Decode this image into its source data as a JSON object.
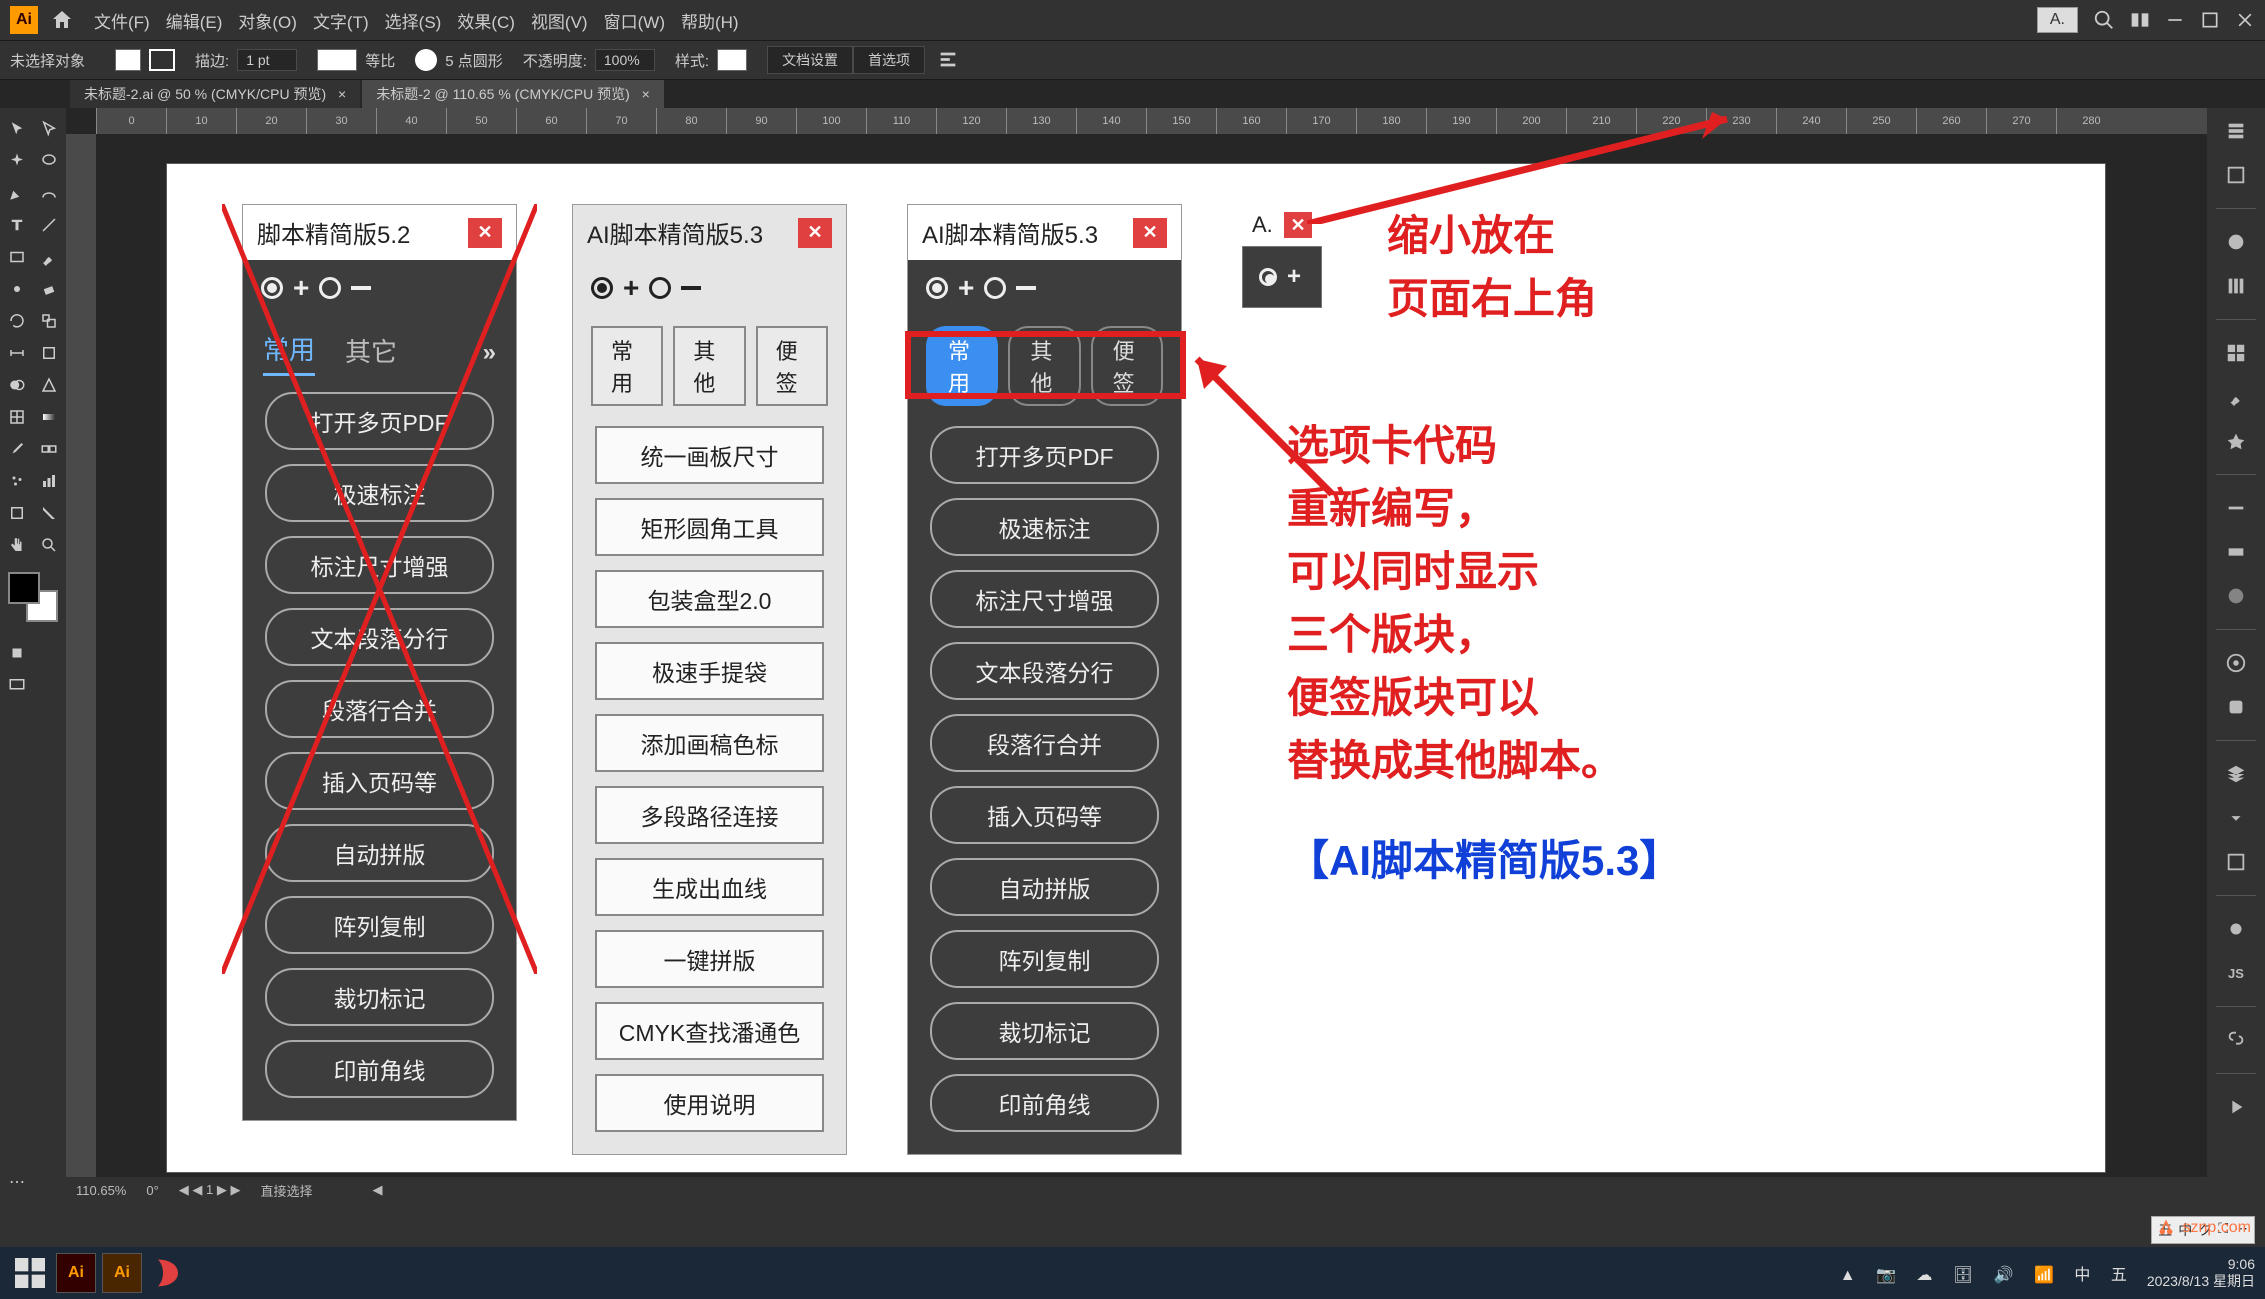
{
  "app": {
    "logo": "Ai"
  },
  "menus": [
    "文件(F)",
    "编辑(E)",
    "对象(O)",
    "文字(T)",
    "选择(S)",
    "效果(C)",
    "视图(V)",
    "窗口(W)",
    "帮助(H)"
  ],
  "topbar": {
    "mini_label": "A."
  },
  "control": {
    "no_selection": "未选择对象",
    "stroke_label": "描边:",
    "stroke_val": "1 pt",
    "uniform": "等比",
    "pt5": "5 点圆形",
    "opacity_label": "不透明度:",
    "opacity_val": "100%",
    "style_label": "样式:",
    "doc_setup": "文档设置",
    "prefs": "首选项"
  },
  "doc_tabs": [
    "未标题-2.ai @ 50 % (CMYK/CPU 预览)",
    "未标题-2 @ 110.65 % (CMYK/CPU 预览)"
  ],
  "ruler_ticks": [
    "0",
    "10",
    "20",
    "30",
    "40",
    "50",
    "60",
    "70",
    "80",
    "90",
    "100",
    "110",
    "120",
    "130",
    "140",
    "150",
    "160",
    "170",
    "180",
    "190",
    "200",
    "210",
    "220",
    "230",
    "240",
    "250",
    "260",
    "270",
    "280"
  ],
  "panel1": {
    "title": "脚本精简版5.2",
    "tabs": [
      "常用",
      "其它"
    ],
    "buttons": [
      "打开多页PDF",
      "极速标注",
      "标注尺寸增强",
      "文本段落分行",
      "段落行合并",
      "插入页码等",
      "自动拼版",
      "阵列复制",
      "裁切标记",
      "印前角线"
    ]
  },
  "panel2": {
    "title": "AI脚本精简版5.3",
    "tabs": [
      "常用",
      "其他",
      "便签"
    ],
    "buttons": [
      "统一画板尺寸",
      "矩形圆角工具",
      "包装盒型2.0",
      "极速手提袋",
      "添加画稿色标",
      "多段路径连接",
      "生成出血线",
      "一键拼版",
      "CMYK查找潘通色",
      "使用说明"
    ]
  },
  "panel3": {
    "title": "AI脚本精简版5.3",
    "tabs": [
      "常用",
      "其他",
      "便签"
    ],
    "buttons": [
      "打开多页PDF",
      "极速标注",
      "标注尺寸增强",
      "文本段落分行",
      "段落行合并",
      "插入页码等",
      "自动拼版",
      "阵列复制",
      "裁切标记",
      "印前角线"
    ]
  },
  "panel4": {
    "title": "A."
  },
  "annotation1": "缩小放在\n页面右上角",
  "annotation2": "选项卡代码\n重新编写，\n可以同时显示\n三个版块，\n便签版块可以\n替换成其他脚本。",
  "annotation3": "【AI脚本精简版5.3】",
  "status": {
    "zoom": "110.65%",
    "angle": "0°",
    "art": "1",
    "tool": "直接选择"
  },
  "tray": [
    "五",
    "中",
    "ク",
    "⛶",
    "⋯"
  ],
  "taskbar": {
    "time": "9:06",
    "date": "2023/8/13 星期日"
  },
  "watermark": "sznp.com"
}
